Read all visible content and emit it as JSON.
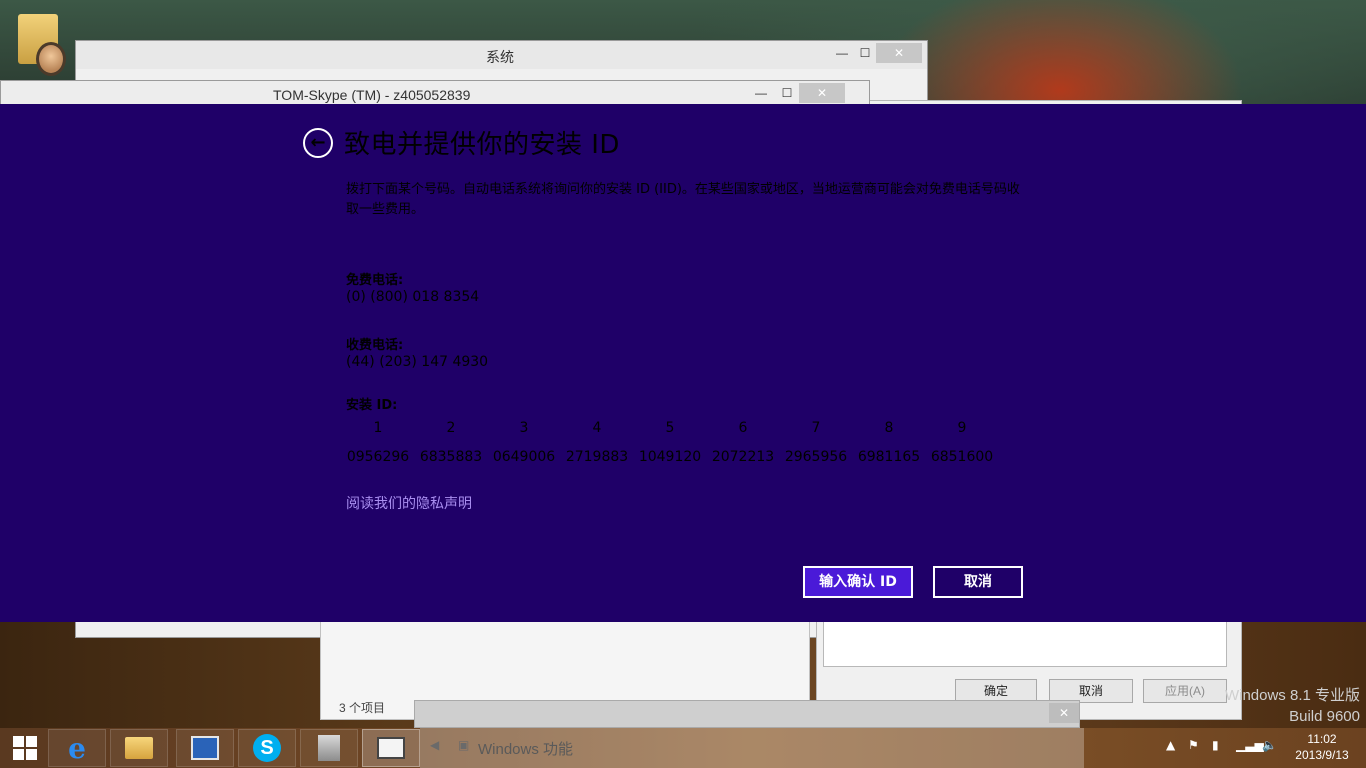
{
  "background_windows": {
    "system_title": "系统",
    "skype_title": "TOM-Skype (TM) - z405052839",
    "explorer_status": "3 个项目",
    "features_title": "Windows 功能",
    "props_buttons": {
      "ok": "确定",
      "cancel": "取消",
      "apply": "应用(A)"
    },
    "watermark": {
      "edition": "Windows 8.1 专业版",
      "build": "Build 9600"
    }
  },
  "dialog": {
    "title": "致电并提供你的安装 ID",
    "description": "拨打下面某个号码。自动电话系统将询问你的安装 ID (IID)。在某些国家或地区，当地运营商可能会对免费电话号码收取一些费用。",
    "toll_free_label": "免费电话:",
    "toll_free_number": "(0) (800) 018 8354",
    "toll_label": "收费电话:",
    "toll_number": "(44) (203) 147 4930",
    "install_id_label": "安装 ID:",
    "install_id_groups": [
      {
        "index": "1",
        "value": "0956296"
      },
      {
        "index": "2",
        "value": "6835883"
      },
      {
        "index": "3",
        "value": "0649006"
      },
      {
        "index": "4",
        "value": "2719883"
      },
      {
        "index": "5",
        "value": "1049120"
      },
      {
        "index": "6",
        "value": "2072213"
      },
      {
        "index": "7",
        "value": "2965956"
      },
      {
        "index": "8",
        "value": "6981165"
      },
      {
        "index": "9",
        "value": "6851600"
      }
    ],
    "privacy_link": "阅读我们的隐私声明",
    "confirm_button": "输入确认 ID",
    "cancel_button": "取消",
    "colors": {
      "background": "#1f0068",
      "primary_button": "#4a1ad8",
      "link": "#a98ef0"
    }
  },
  "taskbar": {
    "apps": [
      "internet-explorer",
      "file-explorer",
      "control-panel",
      "skype",
      "installer-package",
      "system-settings"
    ],
    "clock_time": "11:02",
    "clock_date": "2013/9/13"
  }
}
